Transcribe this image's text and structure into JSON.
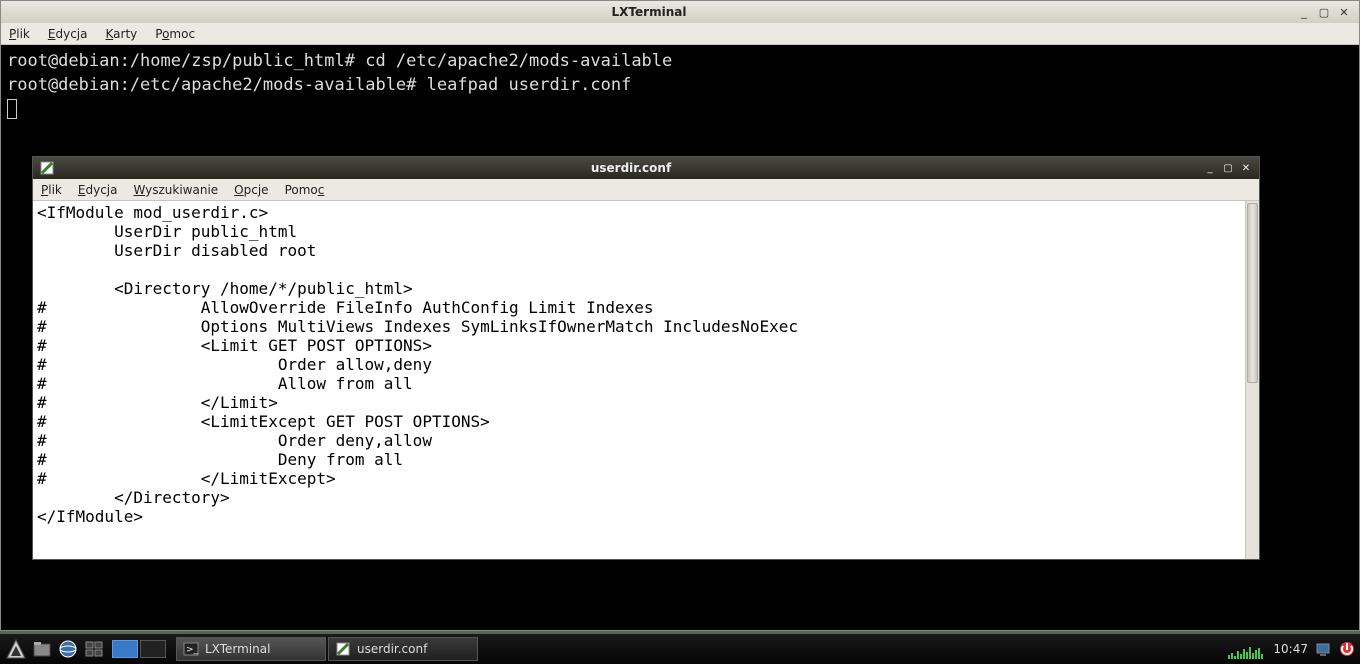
{
  "terminal": {
    "title": "LXTerminal",
    "menu": {
      "file": "Plik",
      "edit": "Edycja",
      "tabs": "Karty",
      "help": "Pomoc"
    },
    "lines": [
      "root@debian:/home/zsp/public_html# cd /etc/apache2/mods-available",
      "root@debian:/etc/apache2/mods-available# leafpad userdir.conf"
    ]
  },
  "leafpad": {
    "title": "userdir.conf",
    "menu": {
      "file": "Plik",
      "edit": "Edycja",
      "search": "Wyszukiwanie",
      "options": "Opcje",
      "help": "Pomoc"
    },
    "content": "<IfModule mod_userdir.c>\n        UserDir public_html\n        UserDir disabled root\n\n        <Directory /home/*/public_html>\n#                AllowOverride FileInfo AuthConfig Limit Indexes\n#                Options MultiViews Indexes SymLinksIfOwnerMatch IncludesNoExec\n#                <Limit GET POST OPTIONS>\n#                        Order allow,deny\n#                        Allow from all\n#                </Limit>\n#                <LimitExcept GET POST OPTIONS>\n#                        Order deny,allow\n#                        Deny from all\n#                </LimitExcept>\n        </Directory>\n</IfModule>\n"
  },
  "taskbar": {
    "tasks": [
      {
        "label": "LXTerminal"
      },
      {
        "label": "userdir.conf"
      }
    ],
    "clock": "10:47"
  },
  "colors": {
    "titlebar_light": "#e8e8e0",
    "titlebar_dark": "#28281f",
    "panel_bg": "#050505"
  }
}
